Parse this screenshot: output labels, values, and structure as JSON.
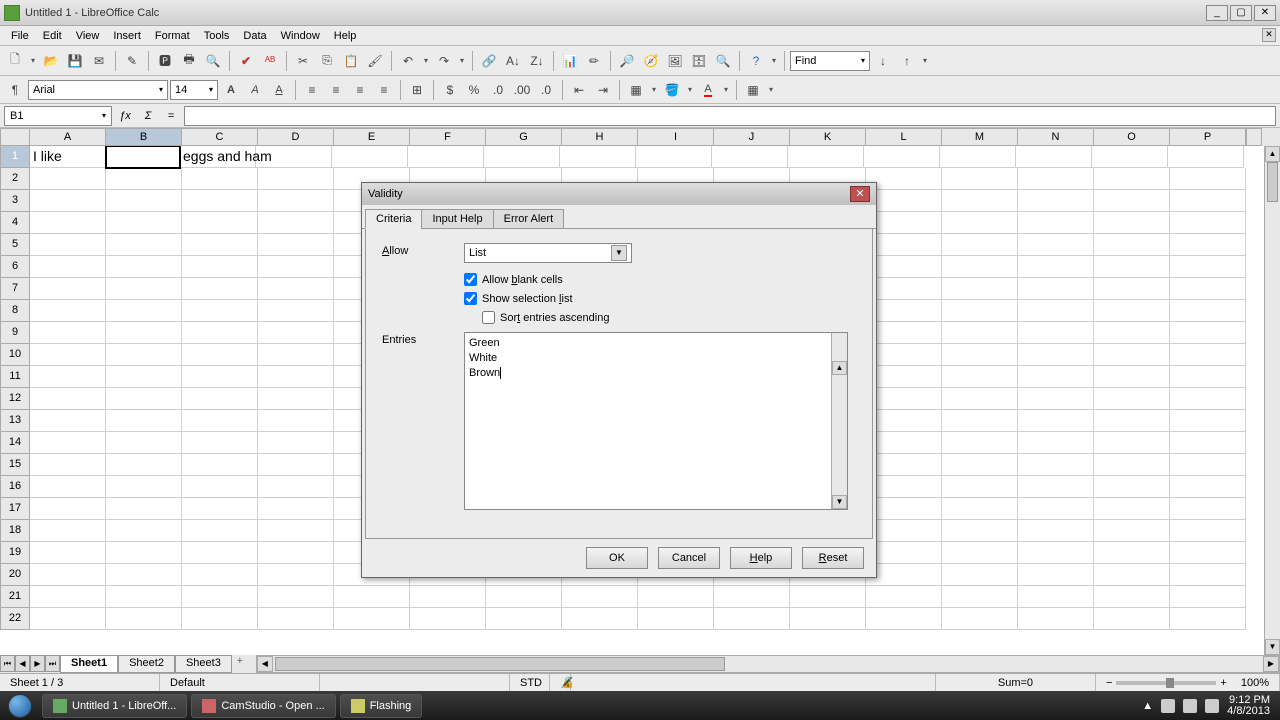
{
  "window": {
    "title": "Untitled 1 - LibreOffice Calc"
  },
  "menus": [
    "File",
    "Edit",
    "View",
    "Insert",
    "Format",
    "Tools",
    "Data",
    "Window",
    "Help"
  ],
  "toolbar": {
    "find": "Find"
  },
  "format": {
    "font": "Arial",
    "size": "14"
  },
  "formula": {
    "cell_ref": "B1",
    "value": ""
  },
  "columns": [
    "A",
    "B",
    "C",
    "D",
    "E",
    "F",
    "G",
    "H",
    "I",
    "J",
    "K",
    "L",
    "M",
    "N",
    "O",
    "P"
  ],
  "cells": {
    "A1": "I like",
    "C1": "eggs and ham"
  },
  "sheets": {
    "tabs": [
      "Sheet1",
      "Sheet2",
      "Sheet3"
    ],
    "active": 0
  },
  "status": {
    "sheet": "Sheet 1 / 3",
    "style": "Default",
    "mode": "STD",
    "sum": "Sum=0",
    "zoom": "100%"
  },
  "dialog": {
    "title": "Validity",
    "tabs": [
      "Criteria",
      "Input Help",
      "Error Alert"
    ],
    "active_tab": 0,
    "allow_label": "Allow",
    "allow_value": "List",
    "allow_blank": "Allow blank cells",
    "show_selection": "Show selection list",
    "sort_asc": "Sort entries ascending",
    "entries_label": "Entries",
    "entries_text": "Green\nWhite\nBrown",
    "buttons": {
      "ok": "OK",
      "cancel": "Cancel",
      "help": "Help",
      "reset": "Reset"
    }
  },
  "taskbar": {
    "items": [
      "Untitled 1 - LibreOff...",
      "CamStudio - Open ...",
      "Flashing"
    ],
    "time": "9:12 PM",
    "date": "4/8/2013"
  }
}
